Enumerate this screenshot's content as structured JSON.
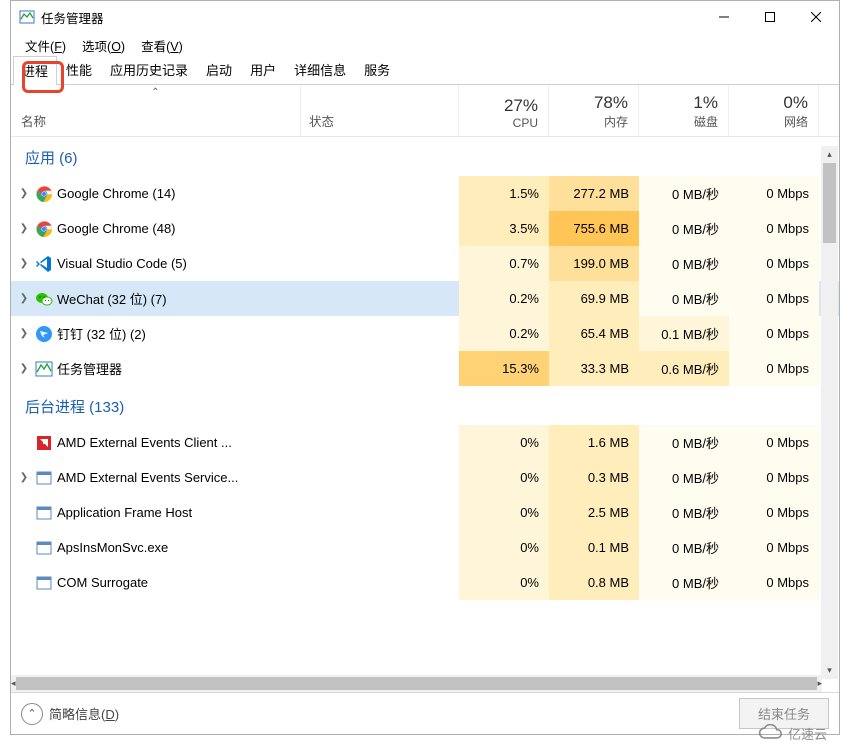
{
  "window": {
    "title": "任务管理器",
    "controls": {
      "min": "—",
      "max": "☐",
      "close": "✕"
    }
  },
  "menubar": [
    {
      "label": "文件",
      "accel": "F"
    },
    {
      "label": "选项",
      "accel": "O"
    },
    {
      "label": "查看",
      "accel": "V"
    }
  ],
  "tabs": [
    "进程",
    "性能",
    "应用历史记录",
    "启动",
    "用户",
    "详细信息",
    "服务"
  ],
  "active_tab": 0,
  "columns": {
    "name": "名称",
    "status": "状态",
    "metrics": [
      {
        "pct": "27%",
        "label": "CPU"
      },
      {
        "pct": "78%",
        "label": "内存"
      },
      {
        "pct": "1%",
        "label": "磁盘"
      },
      {
        "pct": "0%",
        "label": "网络"
      }
    ]
  },
  "groups": [
    {
      "title": "应用 (6)",
      "rows": [
        {
          "icon": "chrome",
          "name": "Google Chrome (14)",
          "exp": true,
          "vals": [
            "1.5%",
            "277.2 MB",
            "0 MB/秒",
            "0 Mbps"
          ],
          "heat": [
            2,
            3,
            0,
            0
          ]
        },
        {
          "icon": "chrome",
          "name": "Google Chrome (48)",
          "exp": true,
          "vals": [
            "3.5%",
            "755.6 MB",
            "0 MB/秒",
            "0 Mbps"
          ],
          "heat": [
            2,
            5,
            0,
            0
          ]
        },
        {
          "icon": "vscode",
          "name": "Visual Studio Code (5)",
          "exp": true,
          "vals": [
            "0.7%",
            "199.0 MB",
            "0 MB/秒",
            "0 Mbps"
          ],
          "heat": [
            1,
            3,
            0,
            0
          ]
        },
        {
          "icon": "wechat",
          "name": "WeChat (32 位) (7)",
          "exp": true,
          "vals": [
            "0.2%",
            "69.9 MB",
            "0 MB/秒",
            "0 Mbps"
          ],
          "heat": [
            1,
            2,
            0,
            0
          ],
          "selected": true
        },
        {
          "icon": "dingtalk",
          "name": "钉钉 (32 位) (2)",
          "exp": true,
          "vals": [
            "0.2%",
            "65.4 MB",
            "0.1 MB/秒",
            "0 Mbps"
          ],
          "heat": [
            1,
            2,
            1,
            0
          ]
        },
        {
          "icon": "taskmgr",
          "name": "任务管理器",
          "exp": true,
          "vals": [
            "15.3%",
            "33.3 MB",
            "0.6 MB/秒",
            "0 Mbps"
          ],
          "heat": [
            4,
            2,
            2,
            0
          ]
        }
      ]
    },
    {
      "title": "后台进程 (133)",
      "rows": [
        {
          "icon": "amd",
          "name": "AMD External Events Client ...",
          "exp": false,
          "vals": [
            "0%",
            "1.6 MB",
            "0 MB/秒",
            "0 Mbps"
          ],
          "heat": [
            1,
            2,
            0,
            0
          ]
        },
        {
          "icon": "generic",
          "name": "AMD External Events Service...",
          "exp": true,
          "vals": [
            "0%",
            "0.3 MB",
            "0 MB/秒",
            "0 Mbps"
          ],
          "heat": [
            1,
            2,
            0,
            0
          ]
        },
        {
          "icon": "generic",
          "name": "Application Frame Host",
          "exp": false,
          "vals": [
            "0%",
            "2.5 MB",
            "0 MB/秒",
            "0 Mbps"
          ],
          "heat": [
            1,
            2,
            0,
            0
          ]
        },
        {
          "icon": "generic",
          "name": "ApsInsMonSvc.exe",
          "exp": false,
          "vals": [
            "0%",
            "0.1 MB",
            "0 MB/秒",
            "0 Mbps"
          ],
          "heat": [
            1,
            2,
            0,
            0
          ]
        },
        {
          "icon": "generic",
          "name": "COM Surrogate",
          "exp": false,
          "vals": [
            "0%",
            "0.8 MB",
            "0 MB/秒",
            "0 Mbps"
          ],
          "heat": [
            1,
            2,
            0,
            0
          ]
        }
      ]
    }
  ],
  "footer": {
    "brief": "简略信息",
    "brief_accel": "D",
    "end_task": "结束任务"
  },
  "watermark": "亿速云"
}
